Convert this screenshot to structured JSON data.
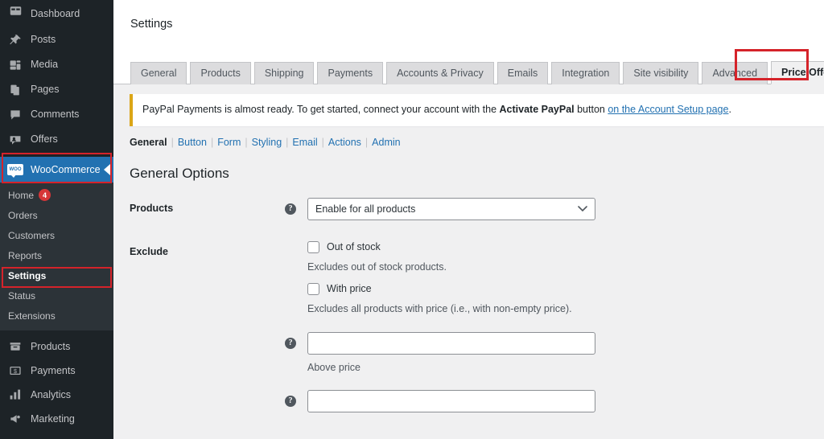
{
  "sidebar": {
    "primary_top": [
      {
        "label": "Dashboard",
        "icon": "dashboard-icon"
      },
      {
        "label": "Posts",
        "icon": "pin-icon"
      },
      {
        "label": "Media",
        "icon": "media-icon"
      },
      {
        "label": "Pages",
        "icon": "pages-icon"
      },
      {
        "label": "Comments",
        "icon": "comments-icon"
      },
      {
        "label": "Offers",
        "icon": "offers-icon"
      }
    ],
    "woocommerce": {
      "label": "WooCommerce",
      "icon": "woo-icon",
      "badge": "WOO"
    },
    "submenu": [
      {
        "label": "Home",
        "count": "4",
        "active": false
      },
      {
        "label": "Orders",
        "count": "",
        "active": false
      },
      {
        "label": "Customers",
        "count": "",
        "active": false
      },
      {
        "label": "Reports",
        "count": "",
        "active": false
      },
      {
        "label": "Settings",
        "count": "",
        "active": true
      },
      {
        "label": "Status",
        "count": "",
        "active": false
      },
      {
        "label": "Extensions",
        "count": "",
        "active": false
      }
    ],
    "primary_bottom": [
      {
        "label": "Products",
        "icon": "products-icon"
      },
      {
        "label": "Payments",
        "icon": "payments-icon"
      },
      {
        "label": "Analytics",
        "icon": "analytics-icon"
      },
      {
        "label": "Marketing",
        "icon": "marketing-icon"
      }
    ]
  },
  "header": {
    "title": "Settings"
  },
  "tabs": [
    {
      "label": "General",
      "active": false
    },
    {
      "label": "Products",
      "active": false
    },
    {
      "label": "Shipping",
      "active": false
    },
    {
      "label": "Payments",
      "active": false
    },
    {
      "label": "Accounts & Privacy",
      "active": false
    },
    {
      "label": "Emails",
      "active": false
    },
    {
      "label": "Integration",
      "active": false
    },
    {
      "label": "Site visibility",
      "active": false
    },
    {
      "label": "Advanced",
      "active": false
    },
    {
      "label": "Price Offers",
      "active": true
    }
  ],
  "notice": {
    "text_part1": "PayPal Payments is almost ready. To get started, connect your account with the ",
    "bold": "Activate PayPal",
    "text_part2": " button ",
    "link": "on the Account Setup page",
    "text_part3": "."
  },
  "subnav": [
    {
      "label": "General",
      "current": true
    },
    {
      "label": "Button",
      "current": false
    },
    {
      "label": "Form",
      "current": false
    },
    {
      "label": "Styling",
      "current": false
    },
    {
      "label": "Email",
      "current": false
    },
    {
      "label": "Actions",
      "current": false
    },
    {
      "label": "Admin",
      "current": false
    }
  ],
  "section": {
    "title": "General Options"
  },
  "fields": {
    "products": {
      "label": "Products",
      "help": "?",
      "selected": "Enable for all products",
      "options": [
        "Enable for all products"
      ]
    },
    "exclude": {
      "label": "Exclude",
      "checkbox1_label": "Out of stock",
      "checkbox1_checked": false,
      "desc1": "Excludes out of stock products.",
      "checkbox2_label": "With price",
      "checkbox2_checked": false,
      "desc2": "Excludes all products with price (i.e., with non-empty price)."
    },
    "above_price": {
      "help": "?",
      "value": "",
      "placeholder": "",
      "below_label": "Above price"
    },
    "second_price": {
      "help": "?",
      "value": "",
      "placeholder": ""
    }
  },
  "annotations": {
    "highlight_color": "#d5232a",
    "arrow": "up-arrow-annotation",
    "boxes": [
      "woocommerce-menu",
      "settings-submenu",
      "price-offers-tab"
    ]
  },
  "colors": {
    "sidebar_bg": "#1d2327",
    "submenu_bg": "#2c3338",
    "active_blue": "#2271b1",
    "content_bg": "#f0f0f1",
    "notice_border": "#dba617",
    "badge_red": "#d63638"
  }
}
